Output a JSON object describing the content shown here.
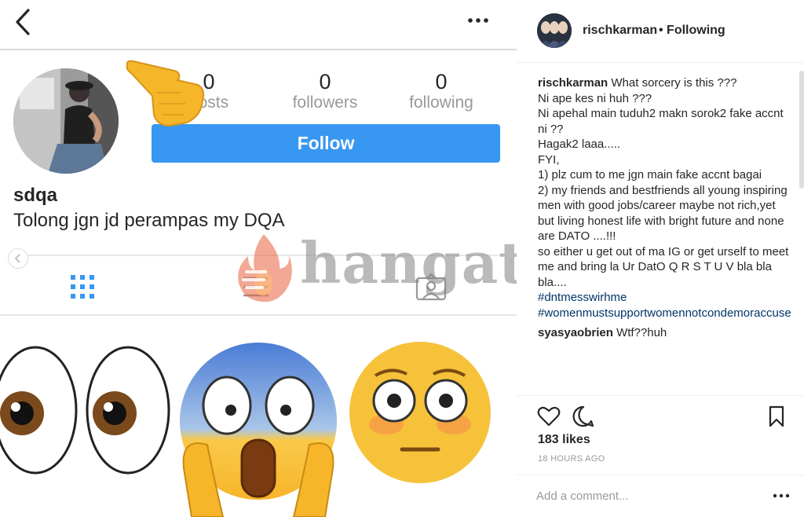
{
  "profile": {
    "stats": [
      {
        "count": "0",
        "label": "posts"
      },
      {
        "count": "0",
        "label": "followers"
      },
      {
        "count": "0",
        "label": "following"
      }
    ],
    "follow_label": "Follow",
    "username": "sdqa",
    "bio": "Tolong jgn jd perampas my DQA"
  },
  "watermark": {
    "text": "hangat.com"
  },
  "post": {
    "username": "rischkarman",
    "follow_status": "• Following",
    "caption_user": "rischkarman",
    "caption_lines": [
      "What sorcery is this ???",
      "Ni ape kes ni huh ???",
      "Ni apehal main tuduh2 makn sorok2 fake accnt ni ??",
      "Hagak2 laaa.....",
      "FYI,",
      "1) plz cum to me jgn main fake accnt bagai",
      "2) my friends and bestfriends all young inspiring men with good jobs/career maybe not rich,yet but living honest life with bright future and none are DATO ....!!!",
      "so either u get out of ma IG or get urself to meet me and bring la Ur DatO Q R S T U V bla bla bla...."
    ],
    "hashtags": [
      "#dntmesswirhme",
      "#womenmustsupportwomennotcondemoraccuse"
    ],
    "comment2_user": "syasyaobrien",
    "comment2_text": "Wtf??huh",
    "likes": "183 likes",
    "time": "18 HOURS AGO",
    "add_comment_placeholder": "Add a comment..."
  },
  "colors": {
    "accent": "#3897f0",
    "hashtag": "#003569",
    "muted": "#999999"
  },
  "icons": [
    "back-icon",
    "more-icon",
    "grid-icon",
    "list-icon",
    "tagged-icon",
    "heart-icon",
    "comment-icon",
    "bookmark-icon",
    "pointing-hand-icon",
    "fire-icon"
  ]
}
